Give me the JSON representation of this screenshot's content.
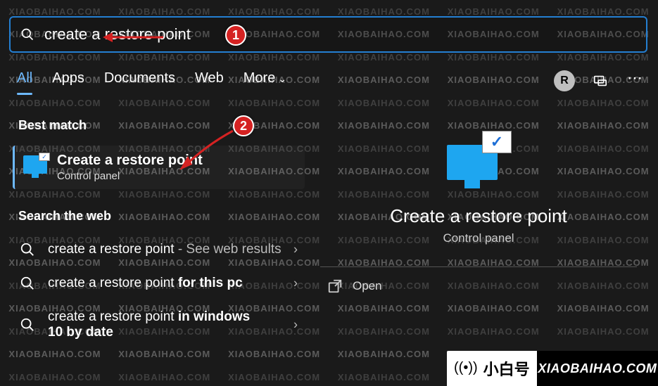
{
  "search": {
    "value": "create a restore point"
  },
  "tabs": {
    "items": [
      "All",
      "Apps",
      "Documents",
      "Web",
      "More"
    ],
    "active_index": 0
  },
  "user_avatar_letter": "R",
  "sections": {
    "best_match_label": "Best match",
    "search_web_label": "Search the web"
  },
  "best_match": {
    "title": "Create a restore point",
    "subtitle": "Control panel"
  },
  "web_results": [
    {
      "prefix": "create a restore point",
      "suffix": " - See web results"
    },
    {
      "prefix": "create a restore point ",
      "suffix": "for this pc"
    },
    {
      "prefix": "create a restore point ",
      "suffix": "in windows 10 by date"
    }
  ],
  "preview": {
    "title": "Create a restore point",
    "subtitle": "Control panel",
    "open_label": "Open"
  },
  "annotations": {
    "one": "1",
    "two": "2"
  },
  "watermark_text": "XIAOBAIHAO.COM",
  "brand": {
    "cn": "小白号",
    "domain": "XIAOBAIHAO.COM"
  }
}
